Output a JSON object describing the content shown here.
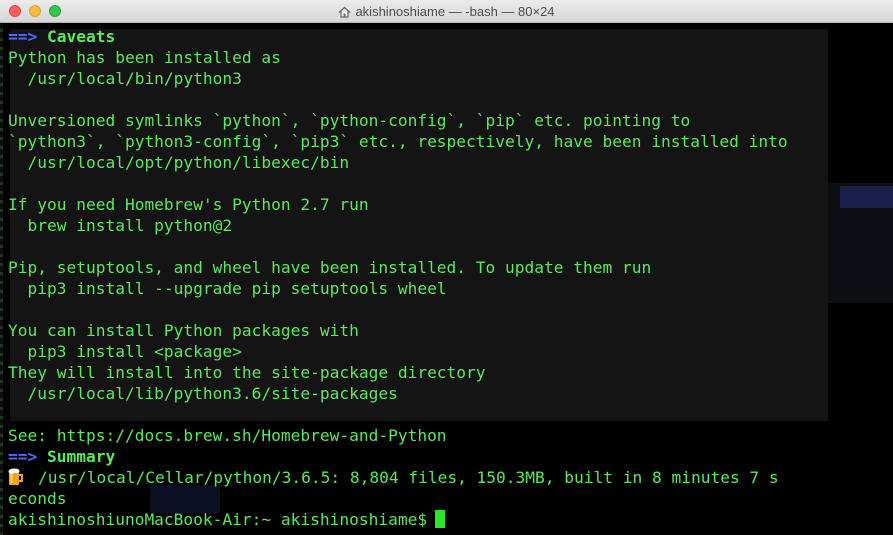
{
  "window": {
    "title": "akishinoshiame — -bash — 80×24",
    "home_icon": "house-icon"
  },
  "colors": {
    "text": "#5de85d",
    "arrow": "#4b6cff",
    "cursor": "#2de42d",
    "background": "#000000"
  },
  "terminal": {
    "caveats_arrow": "==>",
    "caveats_header": "Caveats",
    "l2": "Python has been installed as",
    "l3": "  /usr/local/bin/python3",
    "l5": "Unversioned symlinks `python`, `python-config`, `pip` etc. pointing to",
    "l6": "`python3`, `python3-config`, `pip3` etc., respectively, have been installed into",
    "l7": "  /usr/local/opt/python/libexec/bin",
    "l9": "If you need Homebrew's Python 2.7 run",
    "l10": "  brew install python@2",
    "l12": "Pip, setuptools, and wheel have been installed. To update them run",
    "l13": "  pip3 install --upgrade pip setuptools wheel",
    "l15": "You can install Python packages with",
    "l16": "  pip3 install <package>",
    "l17": "They will install into the site-package directory",
    "l18": "  /usr/local/lib/python3.6/site-packages",
    "l20": "See: https://docs.brew.sh/Homebrew-and-Python",
    "summary_arrow": "==>",
    "summary_header": "Summary",
    "beer_icon": "beer-mug-icon",
    "l22": "/usr/local/Cellar/python/3.6.5: 8,804 files, 150.3MB, built in 8 minutes 7 s",
    "l23": "econds",
    "prompt": "akishinoshiunoMacBook-Air:~ akishinoshiame$"
  }
}
